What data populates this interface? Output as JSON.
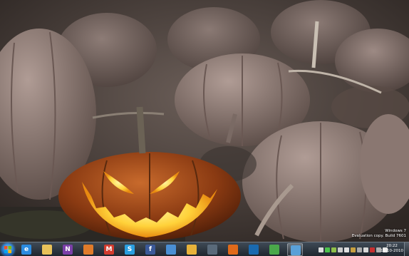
{
  "desktop": {
    "watermark": {
      "line1": "Windows 7",
      "line2": "Evaluation copy. Build 7601"
    }
  },
  "taskbar": {
    "pinned": [
      {
        "name": "ie-icon",
        "color": "#2b8be0",
        "glyph": "e"
      },
      {
        "name": "explorer-folder-icon",
        "color": "#e8c25a",
        "glyph": ""
      },
      {
        "name": "onenote-icon",
        "color": "#7b3fa8",
        "glyph": "N"
      },
      {
        "name": "mail-icon",
        "color": "#e07b2a",
        "glyph": ""
      },
      {
        "name": "gmail-icon",
        "color": "#d23b2e",
        "glyph": "M"
      },
      {
        "name": "skype-icon",
        "color": "#2a9ee0",
        "glyph": "S"
      },
      {
        "name": "facebook-icon",
        "color": "#3b5998",
        "glyph": "f"
      },
      {
        "name": "paint-icon",
        "color": "#4a8fd4",
        "glyph": ""
      },
      {
        "name": "notes-icon",
        "color": "#e8b23a",
        "glyph": ""
      },
      {
        "name": "messenger-icon",
        "color": "#5a6a7a",
        "glyph": ""
      },
      {
        "name": "firefox-icon",
        "color": "#e06a1a",
        "glyph": ""
      },
      {
        "name": "globe-icon",
        "color": "#1a6ab0",
        "glyph": ""
      },
      {
        "name": "people-icon",
        "color": "#4aa84a",
        "glyph": ""
      },
      {
        "name": "window-app-icon",
        "color": "#5aa0d8",
        "glyph": ""
      }
    ],
    "active_index": 13,
    "tray_icons": [
      "#dddddd",
      "#4cc24c",
      "#8fbf4a",
      "#cccccc",
      "#e0e0e0",
      "#c8a040",
      "#aaaaaa",
      "#d8d8d8",
      "#c83030",
      "#b0b0b0",
      "#e8e8e8"
    ],
    "clock": {
      "time": "20:22",
      "date": "19-10-2010"
    }
  }
}
